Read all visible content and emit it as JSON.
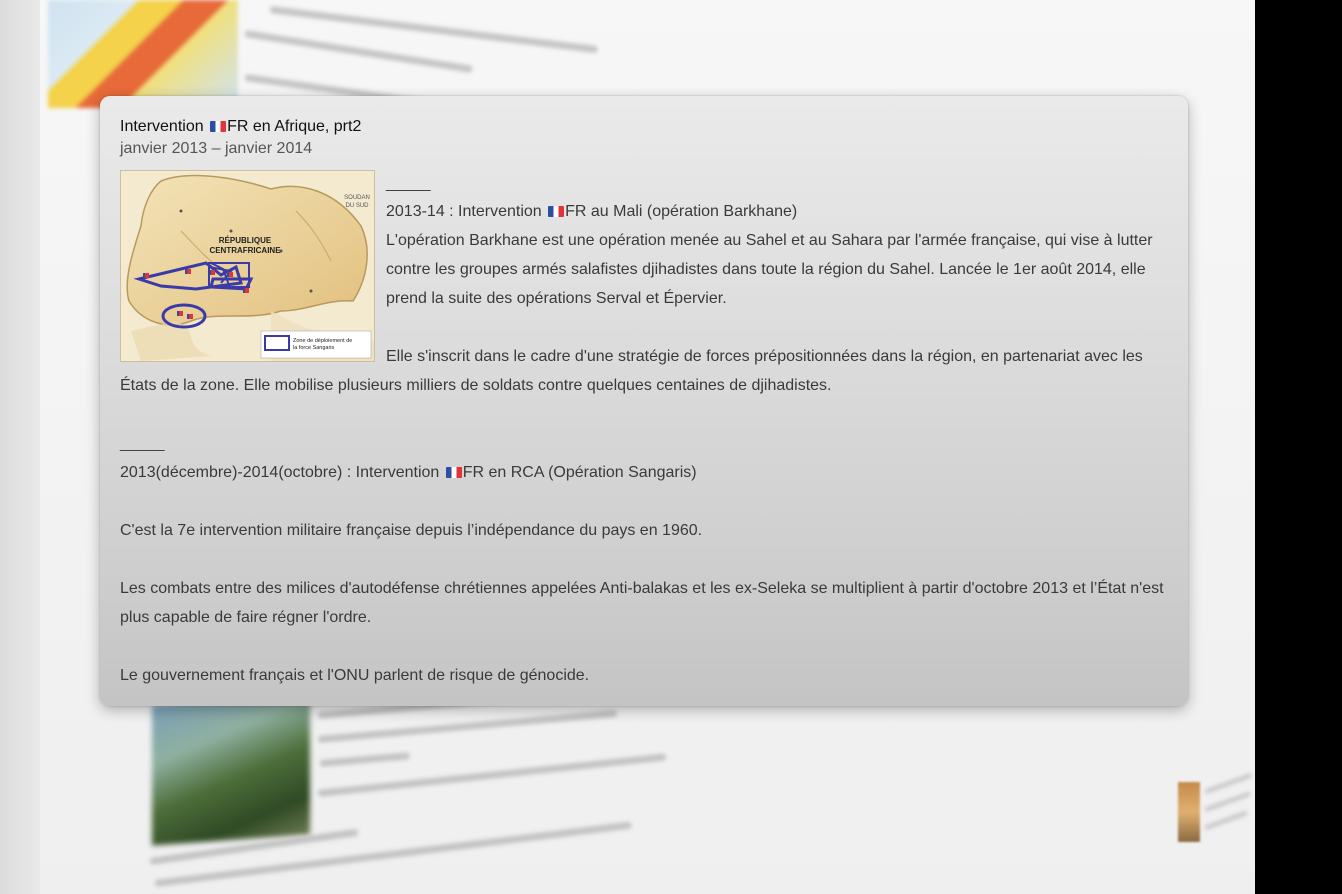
{
  "card": {
    "title_prefix": "Intervention ",
    "title_suffix": "FR en Afrique, prt2",
    "date_range": "janvier 2013 – janvier 2014",
    "map": {
      "label_line1": "RÉPUBLIQUE",
      "label_line2": "CENTRAFRICAINE",
      "neighbor_label_line1": "SOUDAN",
      "neighbor_label_line2": "DU SUD",
      "legend_line1": "Zone de déploiement de",
      "legend_line2": "la force Sangaris"
    },
    "section1": {
      "separator": "_____",
      "heading_prefix": "2013-14 : Intervention ",
      "heading_suffix": "FR au Mali (opération Barkhane)",
      "para1": "L'opération Barkhane est une opération menée au Sahel et au Sahara par l'armée française, qui vise à lutter contre les groupes armés salafistes djihadistes dans toute la région du Sahel. Lancée le 1er août 2014, elle prend la suite des opérations Serval et Épervier.",
      "para2": "Elle s'inscrit dans le cadre d'une stratégie de forces prépositionnées dans la région, en partenariat avec les États de la zone. Elle mobilise plusieurs milliers de soldats contre quelques centaines de djihadistes."
    },
    "section2": {
      "separator": "_____",
      "heading_prefix": "2013(décembre)-2014(octobre) : Intervention ",
      "heading_suffix": "FR en RCA (Opération Sangaris)",
      "para1": "C'est la 7e intervention militaire française depuis l’indépendance du pays en 1960.",
      "para2": "Les combats entre des milices d'autodéfense chrétiennes appelées Anti-balakas et les ex-Seleka se multiplient à partir d'octobre 2013 et l’État n'est plus capable de faire régner l'ordre.",
      "para3": "Le gouvernement français et l'ONU parlent de risque de génocide."
    }
  },
  "colors": {
    "card_top": "#eaeaea",
    "card_bottom": "#c4c4c4",
    "flag_blue": "#2d4fa3",
    "flag_red": "#e0333a",
    "map_sand": "#e9c98a",
    "map_route": "#3b3ba8"
  }
}
